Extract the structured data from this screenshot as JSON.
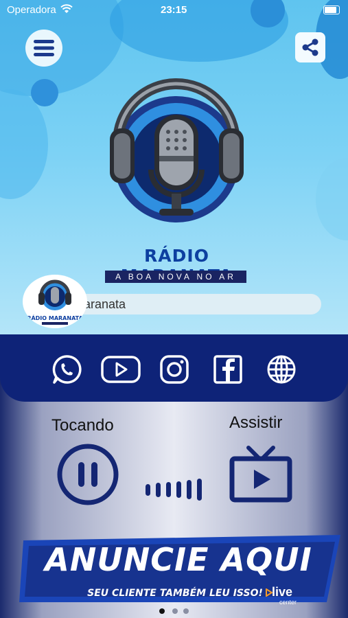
{
  "status_bar": {
    "carrier": "Operadora",
    "time": "23:15"
  },
  "header": {
    "menu_icon": "hamburger-icon",
    "share_icon": "share-icon"
  },
  "brand": {
    "name": "RÁDIO MARANATA",
    "tagline": "A BOA NOVA NO AR"
  },
  "now_playing": {
    "title": "aranata",
    "thumb_caption": "RÁDIO MARANATA"
  },
  "social": {
    "items": [
      {
        "name": "whatsapp",
        "icon": "whatsapp-icon"
      },
      {
        "name": "youtube",
        "icon": "youtube-icon"
      },
      {
        "name": "instagram",
        "icon": "instagram-icon"
      },
      {
        "name": "facebook",
        "icon": "facebook-icon"
      },
      {
        "name": "website",
        "icon": "globe-icon"
      }
    ],
    "bar_color": "#0e2378"
  },
  "player": {
    "playing_label": "Tocando",
    "watch_label": "Assistir",
    "pause_icon": "pause-icon",
    "watch_icon": "tv-play-icon",
    "accent": "#142673"
  },
  "ad": {
    "title": "ANUNCIE AQUI",
    "subtitle": "SEU CLIENTE TAMBÉM LEU ISSO!",
    "brand": "live",
    "brand_sub": "center"
  },
  "pager": {
    "count": 3,
    "active": 1
  }
}
